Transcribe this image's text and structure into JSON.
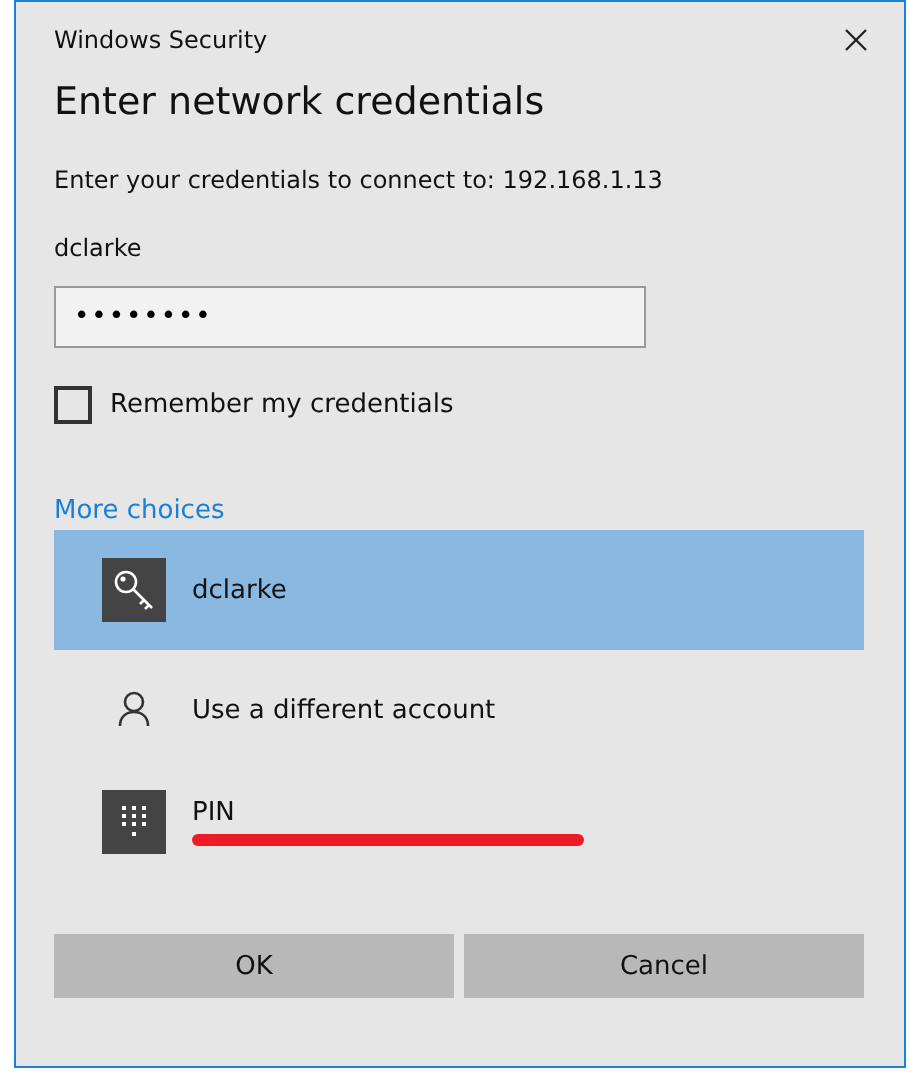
{
  "window": {
    "title": "Windows Security"
  },
  "heading": "Enter network credentials",
  "prompt": "Enter your credentials to connect to: 192.168.1.13",
  "username": "dclarke",
  "password": {
    "value": "••••••••"
  },
  "remember": {
    "label": "Remember my credentials",
    "checked": false
  },
  "more_choices": "More choices",
  "choices": [
    {
      "kind": "key",
      "label": "dclarke",
      "selected": true
    },
    {
      "kind": "person",
      "label": "Use a different account",
      "selected": false
    },
    {
      "kind": "pin",
      "label": "PIN",
      "selected": false
    }
  ],
  "buttons": [
    "OK",
    "Cancel"
  ]
}
